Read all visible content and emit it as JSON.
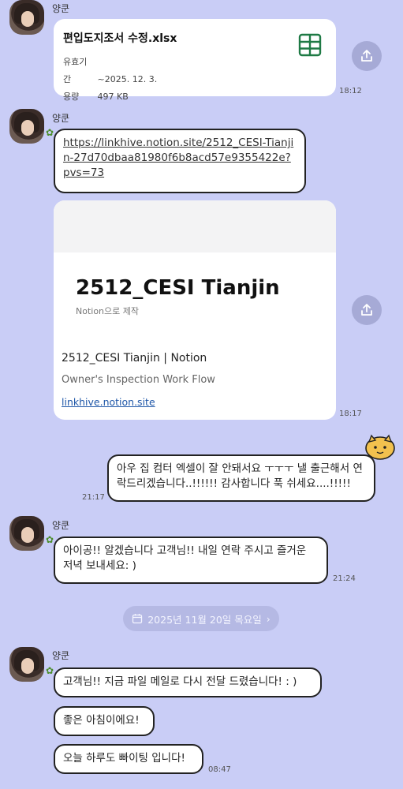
{
  "sender_name": "양쿤",
  "messages": {
    "file": {
      "filename": "편입도지조서 수정.xlsx",
      "expiry_label": "유효기간",
      "expiry_value": "~2025. 12. 3.",
      "size_label": "용량",
      "size_value": "497 KB",
      "time": "18:12"
    },
    "link_text": "https://linkhive.notion.site/2512_CESI-Tianjin-27d70dbaa81980f6b8acd57e9355422e?pvs=73",
    "link_preview": {
      "big_title": "2512_CESI Tianjin",
      "made_with": "Notion으로 제작",
      "title": "2512_CESI Tianjin | Notion",
      "description": "Owner's Inspection Work Flow",
      "domain": "linkhive.notion.site",
      "time": "18:17"
    },
    "my_msg": {
      "text": "아우 집 컴터 엑셀이 잘 안돼서요 ㅜㅜㅜ 낼 출근해서 연락드리겠습니다..!!!!!! 감사합니다 푹 쉬세요....!!!!!",
      "time": "21:17"
    },
    "reply1": {
      "text": "아이공!! 알겠습니다 고객님!! 내일 연락 주시고 즐거운 저녁 보내세요: )",
      "time": "21:24"
    },
    "date_divider": "2025년 11월 20일 목요일",
    "reply2": {
      "text": "고객님!! 지금 파일 메일로 다시 전달 드렸습니다! : )"
    },
    "reply3": {
      "text": "좋은 아침이에요!"
    },
    "reply4": {
      "text": "오늘 하루도 빠이팅 입니다!",
      "time": "08:47"
    }
  },
  "colors": {
    "background": "#c9cdf6",
    "bubble": "#ffffff",
    "share_button": "#a6aad6",
    "link_domain": "#1f57a8",
    "excel_green": "#1f7a45"
  }
}
